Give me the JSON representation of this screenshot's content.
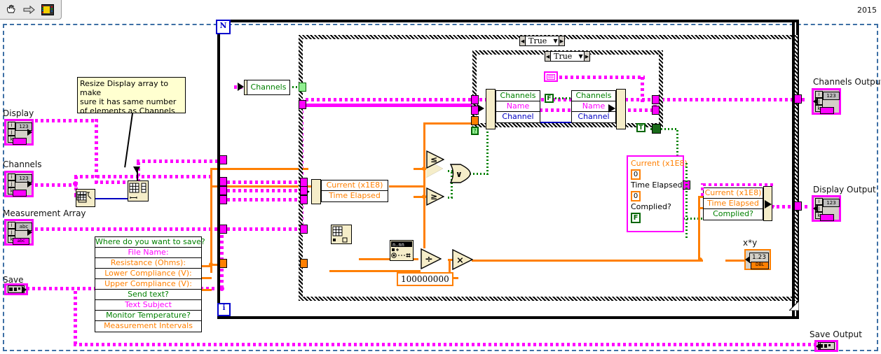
{
  "window": {
    "year_label": "2015",
    "toolbar": {
      "items": [
        {
          "name": "hand-tool-icon",
          "glyph": "hand"
        },
        {
          "name": "run-arrow-icon",
          "glyph": "arrow"
        },
        {
          "name": "vi-icon",
          "glyph": "vi"
        }
      ]
    }
  },
  "comment": {
    "name": "resize-display-comment",
    "lines": [
      "Resize Display array to make",
      "sure it has same number",
      "of elements as Channels"
    ]
  },
  "inputs": [
    {
      "label": "Display",
      "type": "array",
      "datatype": "123"
    },
    {
      "label": "Channels",
      "type": "array",
      "datatype": "123"
    },
    {
      "label": "Measurement Array",
      "type": "array",
      "datatype": "abc"
    },
    {
      "label": "Save",
      "type": "refnum",
      "datatype": ""
    }
  ],
  "outputs": [
    {
      "label": "Channels Output",
      "type": "array",
      "datatype": "123"
    },
    {
      "label": "Display Output",
      "type": "array",
      "datatype": "123"
    },
    {
      "label": "Save Output",
      "type": "refnum",
      "datatype": ""
    }
  ],
  "loops": {
    "outer_count_label": "N",
    "inner_index_label": "i"
  },
  "cases": [
    {
      "name": "outer-case-selector",
      "value": "True"
    },
    {
      "name": "inner-case-selector",
      "value": "True"
    }
  ],
  "save_cluster": {
    "name": "save-settings-cluster",
    "rows": [
      {
        "text": "Where do you want to save?",
        "color": "green"
      },
      {
        "text": "File Name:",
        "color": "magenta"
      },
      {
        "text": "Resistance (Ohms):",
        "color": "orange"
      },
      {
        "text": "Lower Compliance (V):",
        "color": "orange"
      },
      {
        "text": "Upper Compliance (V):",
        "color": "orange"
      },
      {
        "text": "Send text?",
        "color": "green"
      },
      {
        "text": "Text Subject",
        "color": "magenta"
      },
      {
        "text": "Monitor Temperature?",
        "color": "green"
      },
      {
        "text": "Measurement Intervals",
        "color": "orange"
      }
    ]
  },
  "channels_label_node": {
    "name": "channels-unbundle",
    "text": "Channels"
  },
  "bundle_left": {
    "name": "channel-cluster-left",
    "rows": [
      {
        "text": "Channels",
        "color": "green"
      },
      {
        "text": "Name",
        "color": "magenta"
      },
      {
        "text": "Channel",
        "color": "blue"
      }
    ]
  },
  "bundle_right": {
    "name": "channel-cluster-right",
    "rows": [
      {
        "text": "Channels",
        "color": "green"
      },
      {
        "text": "Name",
        "color": "magenta"
      },
      {
        "text": "Channel",
        "color": "blue"
      }
    ]
  },
  "current_cluster_small": {
    "name": "current-time-unbundle",
    "rows": [
      {
        "text": "Current (x1E8)",
        "color": "orange"
      },
      {
        "text": "Time Elapsed",
        "color": "orange"
      }
    ]
  },
  "current_cluster_bundle": {
    "name": "current-time-complied-bundle",
    "rows": [
      {
        "text": "Current (x1E8)",
        "color": "orange"
      },
      {
        "text": "0",
        "color": "orange",
        "is_constant": true
      },
      {
        "text": "Time Elapsed",
        "color": "black"
      },
      {
        "text": "0",
        "color": "orange",
        "is_constant": true
      },
      {
        "text": "Complied?",
        "color": "black"
      },
      {
        "text": "F",
        "color": "green",
        "is_constant": true
      }
    ]
  },
  "current_cluster_right": {
    "name": "current-time-complied-unbundle",
    "rows": [
      {
        "text": "Current (x1E8)",
        "color": "orange"
      },
      {
        "text": "Time Elapsed",
        "color": "orange"
      },
      {
        "text": "Complied?",
        "color": "green"
      }
    ]
  },
  "constants": {
    "big_number": "100000000",
    "boolean_false": "F",
    "boolean_true": "T",
    "zero_a": "0",
    "zero_b": "0",
    "false_in_cluster": "F"
  },
  "operators": [
    {
      "name": "less-than-node",
      "symbol": "≤"
    },
    {
      "name": "greater-than-node",
      "symbol": "≥"
    },
    {
      "name": "or-node",
      "symbol": "∨"
    },
    {
      "name": "divide-node",
      "symbol": "÷"
    },
    {
      "name": "multiply-node",
      "symbol": "×"
    }
  ],
  "indicator": {
    "name": "xy-indicator",
    "label": "x*y",
    "value": "1.23",
    "type_tag": "DBL"
  },
  "colors": {
    "magenta": "#ff00ff",
    "orange": "#ff7f00",
    "green": "#008000",
    "blue": "#0000c0",
    "comment_bg": "#ffffd0",
    "node_bg": "#f5edc9",
    "diagram_border": "#3d6fa5"
  }
}
